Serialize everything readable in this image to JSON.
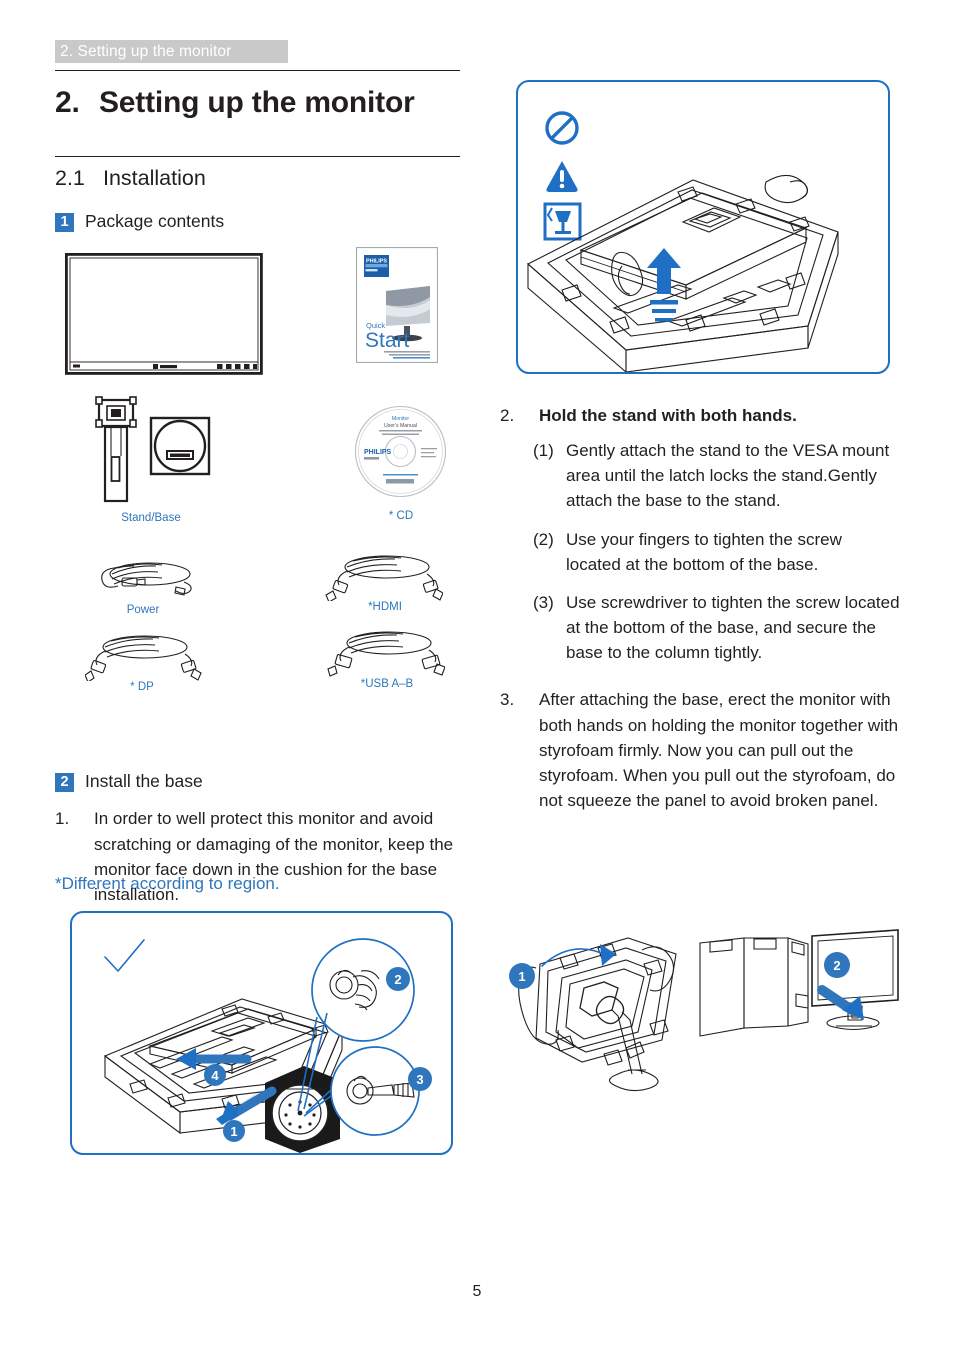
{
  "running_head": "2. Setting up the monitor",
  "chapter": {
    "number": "2.",
    "title": "Setting up the monitor"
  },
  "section": {
    "number": "2.1",
    "title": "Installation"
  },
  "blocks": {
    "package_contents": {
      "badge": "1",
      "label": "Package contents"
    },
    "install_base": {
      "badge": "2",
      "label": "Install the base"
    }
  },
  "package_items": [
    {
      "name": "monitor",
      "caption": ""
    },
    {
      "name": "quick-start-guide",
      "caption": "",
      "cover_kicker": "Quick",
      "cover_title": "Start",
      "brand": "PHILIPS"
    },
    {
      "name": "stand-base",
      "caption": "Stand/Base"
    },
    {
      "name": "cd",
      "caption": "* CD",
      "brand": "PHILIPS",
      "disc_title": "Monitor User's Manual"
    },
    {
      "name": "power-cable",
      "caption": "Power"
    },
    {
      "name": "hdmi-cable",
      "caption": "*HDMI"
    },
    {
      "name": "dp-cable",
      "caption": "* DP"
    },
    {
      "name": "usb-cable",
      "caption": "*USB A–B"
    }
  ],
  "region_note": "*Different according to region.",
  "steps_left": [
    {
      "marker": "1.",
      "text": "In order to well protect this monitor and avoid scratching or damaging of the monitor, keep the monitor face down in the cushion for the base installation."
    }
  ],
  "steps_right": [
    {
      "marker": "2.",
      "text": "Hold the stand with both hands.",
      "bold": true
    },
    {
      "marker": "(1)",
      "text": "Gently attach the stand to the VESA mount area until the latch locks the stand.Gently attach the base to the stand.",
      "indent": true
    },
    {
      "marker": "(2)",
      "text": "Use your fingers to tighten the screw located at the bottom of the base.",
      "indent": true
    },
    {
      "marker": "(3)",
      "text": "Use screwdriver to tighten the screw located at the bottom of the base, and secure the base to the column tightly.",
      "indent": true
    },
    {
      "marker": "3.",
      "text": "After attaching the base, erect the monitor with both hands on holding the monitor together with styrofoam firmly. Now you can pull out the styrofoam. When you pull out the styrofoam, do not squeeze the panel to avoid broken panel."
    }
  ],
  "figures": {
    "top_right": {
      "name": "unpack-warning-figure",
      "icons": [
        "prohibition-icon",
        "warning-triangle-icon",
        "fragile-glass-icon"
      ],
      "callouts": []
    },
    "bottom_left": {
      "name": "base-installation-figure",
      "icons": [
        "checkmark-icon"
      ],
      "callouts": [
        "1",
        "2",
        "3",
        "4"
      ]
    },
    "bottom_right": {
      "name": "erect-monitor-figure",
      "callouts": [
        "1",
        "2"
      ]
    }
  },
  "page_number": "5",
  "colors": {
    "accent_blue": "#2f76bc",
    "figure_border": "#1f6fc4",
    "runhead_bg": "#c9c9c9",
    "text": "#231f20"
  }
}
